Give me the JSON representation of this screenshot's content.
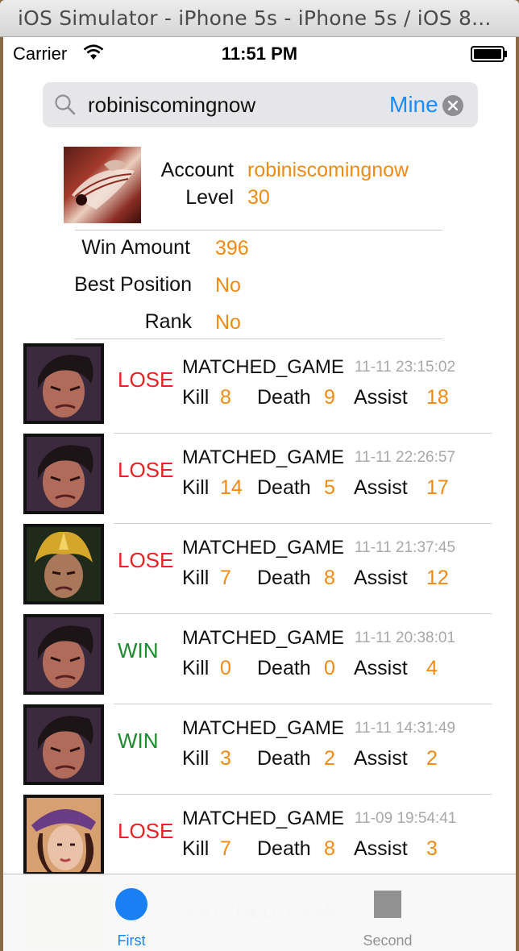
{
  "window": {
    "title": "iOS Simulator - iPhone 5s - iPhone 5s / iOS 8..."
  },
  "status_bar": {
    "carrier": "Carrier",
    "time": "11:51 PM"
  },
  "search": {
    "value": "robiniscomingnow",
    "scope_label": "Mine"
  },
  "profile": {
    "account_label": "Account",
    "account_value": "robiniscomingnow",
    "level_label": "Level",
    "level_value": "30",
    "win_amount_label": "Win Amount",
    "win_amount_value": "396",
    "best_position_label": "Best Position",
    "best_position_value": "No",
    "rank_label": "Rank",
    "rank_value": "No"
  },
  "stat_labels": {
    "kill": "Kill",
    "death": "Death",
    "assist": "Assist"
  },
  "matches": [
    {
      "result": "LOSE",
      "type": "MATCHED_GAME",
      "time": "11-11 23:15:02",
      "kill": "8",
      "death": "9",
      "assist": "18",
      "champion_icon": "dark-hair-champion-icon"
    },
    {
      "result": "LOSE",
      "type": "MATCHED_GAME",
      "time": "11-11 22:26:57",
      "kill": "14",
      "death": "5",
      "assist": "17",
      "champion_icon": "dark-hair-champion-icon"
    },
    {
      "result": "LOSE",
      "type": "MATCHED_GAME",
      "time": "11-11 21:37:45",
      "kill": "7",
      "death": "8",
      "assist": "12",
      "champion_icon": "golden-helmet-champion-icon"
    },
    {
      "result": "WIN",
      "type": "MATCHED_GAME",
      "time": "11-11 20:38:01",
      "kill": "0",
      "death": "0",
      "assist": "4",
      "champion_icon": "dark-hair-champion-icon"
    },
    {
      "result": "WIN",
      "type": "MATCHED_GAME",
      "time": "11-11 14:31:49",
      "kill": "3",
      "death": "2",
      "assist": "2",
      "champion_icon": "dark-hair-champion-icon"
    },
    {
      "result": "LOSE",
      "type": "MATCHED_GAME",
      "time": "11-09 19:54:41",
      "kill": "7",
      "death": "8",
      "assist": "3",
      "champion_icon": "purple-hat-champion-icon"
    }
  ],
  "partial_row": {
    "type": "MATCHED_GAME"
  },
  "tabs": [
    {
      "label": "First",
      "icon": "circle-icon",
      "selected": true
    },
    {
      "label": "Second",
      "icon": "square-icon",
      "selected": false
    }
  ],
  "colors": {
    "accent": "#1a7ff5",
    "value_orange": "#f08a13",
    "lose_red": "#e52323",
    "win_green": "#1d8a2c"
  }
}
